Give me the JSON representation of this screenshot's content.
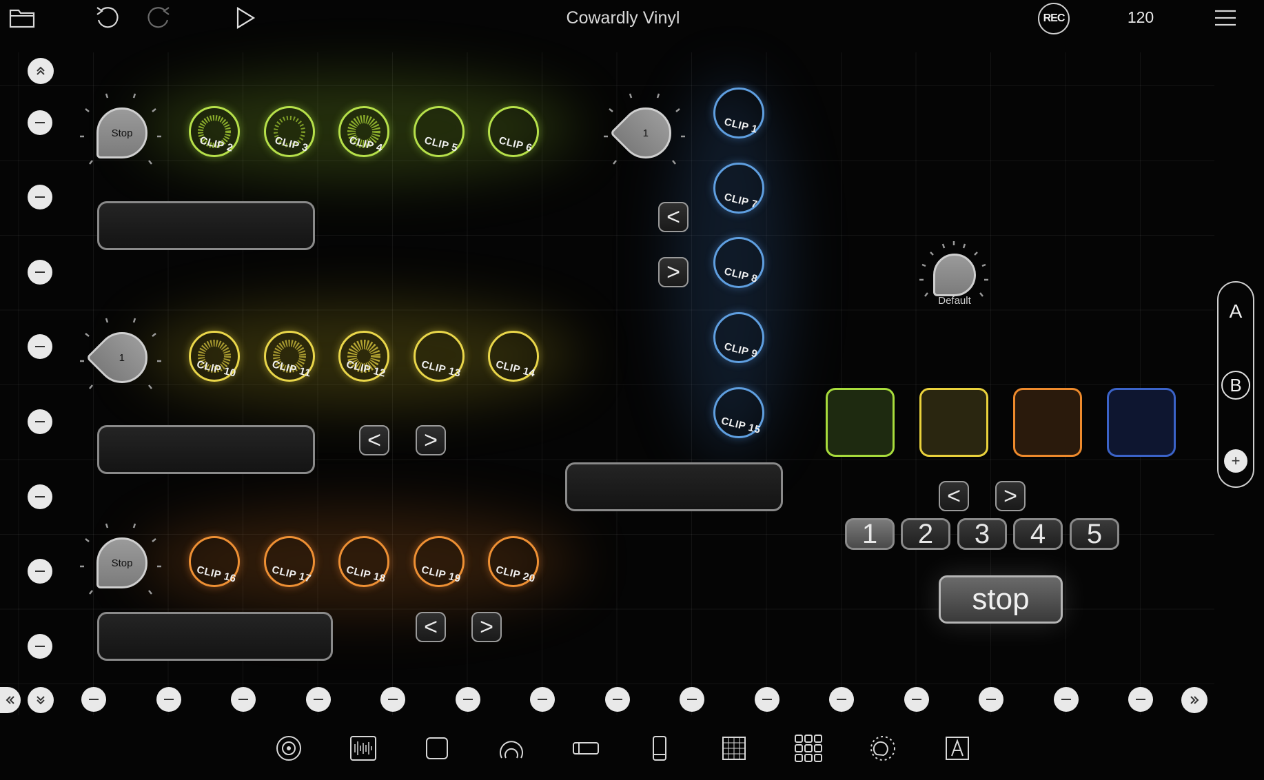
{
  "app": {
    "title": "Cowardly Vinyl"
  },
  "toolbar": {
    "folder_icon": "folder-icon",
    "undo_icon": "undo-icon",
    "redo_icon": "redo-icon",
    "play_icon": "play-icon",
    "rec_label": "REC",
    "bpm": "120",
    "menu_icon": "hamburger-menu-icon"
  },
  "knobs": {
    "row1": "Stop",
    "row2": "1",
    "row3": "Stop",
    "blue": "1",
    "default_label": "Default"
  },
  "clips": {
    "row1": [
      "CLIP 2",
      "CLIP 3",
      "CLIP 4",
      "CLIP 5",
      "CLIP 6"
    ],
    "row2": [
      "CLIP 10",
      "CLIP 11",
      "CLIP 12",
      "CLIP 13",
      "CLIP 14"
    ],
    "row3": [
      "CLIP 16",
      "CLIP 17",
      "CLIP 18",
      "CLIP 19",
      "CLIP 20"
    ],
    "blue": [
      "CLIP 1",
      "CLIP 7",
      "CLIP 8",
      "CLIP 9",
      "CLIP 15"
    ]
  },
  "colors": {
    "green": "#b6e04a",
    "yellow": "#e9d64a",
    "orange": "#ee9034",
    "blue": "#5f9fe0",
    "pad_green": "#a8dc3c",
    "pad_yellow": "#ead23c",
    "pad_orange": "#ee8a2c",
    "pad_blue": "#3b63c8"
  },
  "nav": {
    "prev": "<",
    "next": ">"
  },
  "banks": [
    "1",
    "2",
    "3",
    "4",
    "5"
  ],
  "selected_bank": "1",
  "stop_label": "stop",
  "ab_panel": {
    "a": "A",
    "b": "B",
    "add": "+"
  },
  "bottom_tools": [
    "knob-tool-icon",
    "waveform-tool-icon",
    "square-pad-tool-icon",
    "arc-knob-tool-icon",
    "slider-tool-icon",
    "phone-layout-tool-icon",
    "grid-tool-icon",
    "pad-grid-tool-icon",
    "dial-tool-icon",
    "text-tool-icon"
  ]
}
